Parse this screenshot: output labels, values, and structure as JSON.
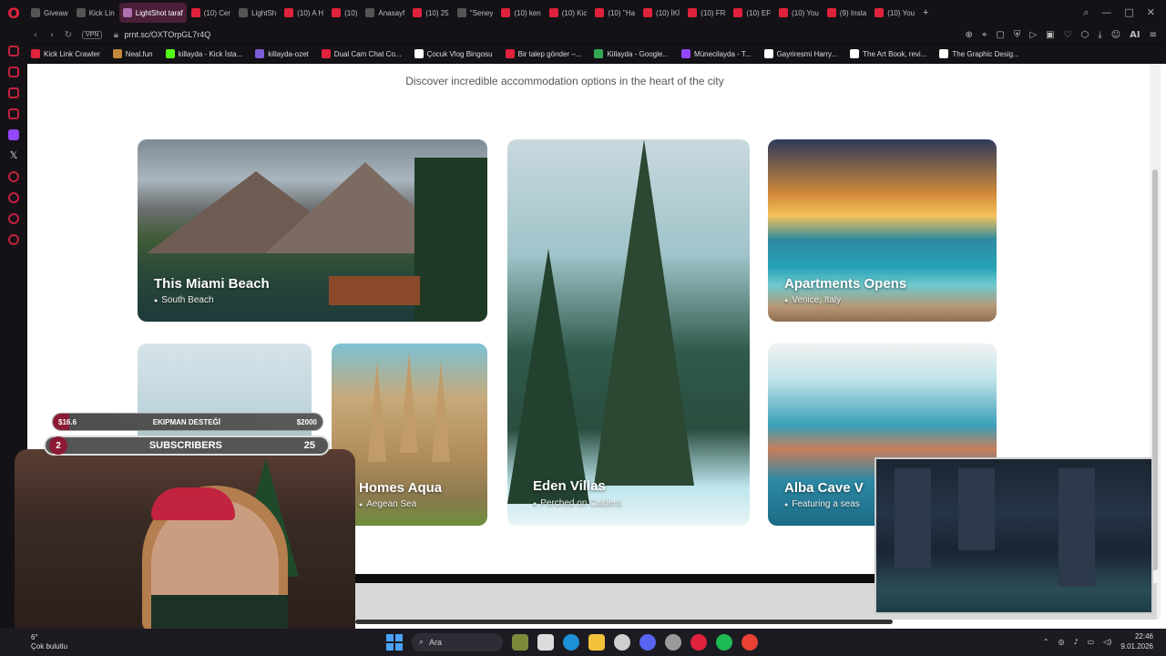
{
  "browser": {
    "tabs": [
      {
        "label": "Giveaw",
        "active": false
      },
      {
        "label": "Kick Lin",
        "active": false
      },
      {
        "label": "LightShot taraf",
        "active": true
      },
      {
        "label": "(10) Cer",
        "active": false
      },
      {
        "label": "LightSh",
        "active": false
      },
      {
        "label": "(10) A H",
        "active": false
      },
      {
        "label": "(10)",
        "active": false
      },
      {
        "label": "Anasayf",
        "active": false
      },
      {
        "label": "(10) 25",
        "active": false
      },
      {
        "label": "''Seney",
        "active": false
      },
      {
        "label": "(10) ken",
        "active": false
      },
      {
        "label": "(10) Kic",
        "active": false
      },
      {
        "label": "(10) ''Ha",
        "active": false
      },
      {
        "label": "(10) İKİ",
        "active": false
      },
      {
        "label": "(10) FR",
        "active": false
      },
      {
        "label": "(10) EF",
        "active": false
      },
      {
        "label": "(10) You",
        "active": false
      },
      {
        "label": "(9) Insta",
        "active": false
      },
      {
        "label": "(10) You",
        "active": false
      }
    ],
    "new_tab": "+",
    "vpn_label": "VPN",
    "url": "prnt.sc/OXTOrpGL7r4Q",
    "ai_label": "AI",
    "bookmarks": [
      {
        "label": "Kick Link Crawler",
        "color": "#e0223c"
      },
      {
        "label": "Neal.fun",
        "color": "#c48a3a"
      },
      {
        "label": "killayda - Kick İsta...",
        "color": "#53fc18"
      },
      {
        "label": "killayda-ozet",
        "color": "#7c5cd6"
      },
      {
        "label": "Dual Cam Chat Co...",
        "color": "#e0223c"
      },
      {
        "label": "Çocuk Vlog Bingosu",
        "color": "#ffffff"
      },
      {
        "label": "Bir talep gönder –...",
        "color": "#e0223c"
      },
      {
        "label": "Killayda - Google...",
        "color": "#34a853"
      },
      {
        "label": "Münecilayda - T...",
        "color": "#9146ff"
      },
      {
        "label": "Gayriresmi Harry...",
        "color": "#ffffff"
      },
      {
        "label": "The Art Book, revi...",
        "color": "#ffffff"
      },
      {
        "label": "The Graphic Desig...",
        "color": "#ffffff"
      }
    ]
  },
  "content": {
    "subtitle": "Discover incredible accommodation options in the heart of the city",
    "cards": {
      "miami": {
        "title": "This Miami Beach",
        "location": "South Beach"
      },
      "eden": {
        "title": "Eden Villas",
        "location": "Perched on Caldera"
      },
      "apts": {
        "title": "Apartments Opens",
        "location": "Venice, Italy"
      },
      "homes": {
        "title": "Homes  Aqua",
        "location": "Aegean Sea"
      },
      "alba": {
        "title": "Alba Cave V",
        "location": "Featuring a seas"
      }
    }
  },
  "overlay": {
    "goal": {
      "current": "$16.6",
      "label": "EKIPMAN DESTEĞİ",
      "target": "$2000"
    },
    "subs": {
      "count": "2",
      "label": "SUBSCRIBERS",
      "target": "25"
    }
  },
  "taskbar": {
    "weather_temp": "6°",
    "weather_text": "Çok bulutlu",
    "search_label": "Ara",
    "time": "22:46",
    "date": "9.01.2026"
  }
}
